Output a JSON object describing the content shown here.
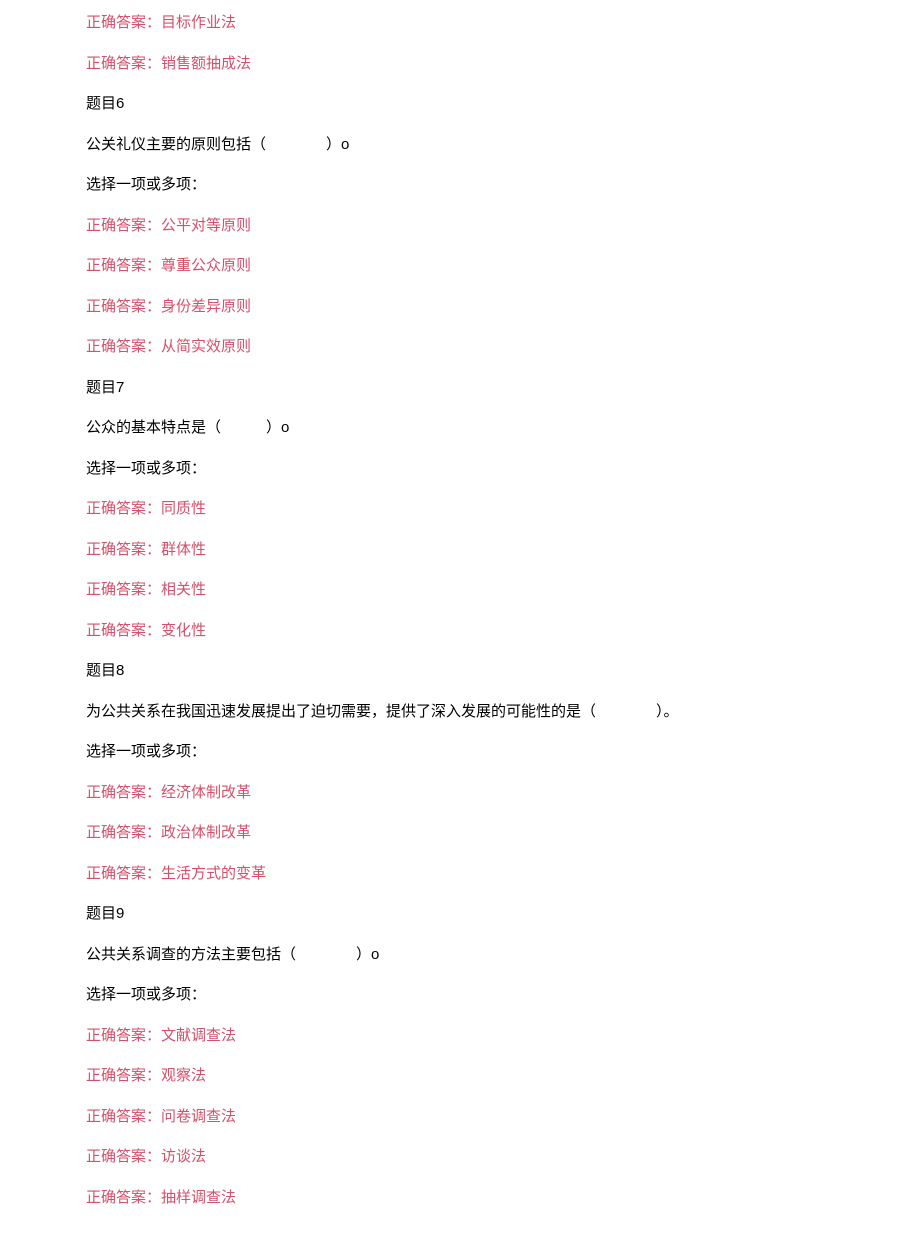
{
  "top_answers": [
    "正确答案：目标作业法",
    "正确答案：销售额抽成法"
  ],
  "q6": {
    "title": "题目6",
    "prompt": "公关礼仪主要的原则包括（　　　　）o",
    "instruction": "选择一项或多项：",
    "answers": [
      "正确答案：公平对等原则",
      "正确答案：尊重公众原则",
      "正确答案：身份差异原则",
      "正确答案：从简实效原则"
    ]
  },
  "q7": {
    "title": "题目7",
    "prompt": "公众的基本特点是（　　　）o",
    "instruction": "选择一项或多项：",
    "answers": [
      "正确答案：同质性",
      "正确答案：群体性",
      "正确答案：相关性",
      "正确答案：变化性"
    ]
  },
  "q8": {
    "title": "题目8",
    "prompt": "为公共关系在我国迅速发展提出了迫切需要，提供了深入发展的可能性的是（　　　　）。",
    "instruction": "选择一项或多项：",
    "answers": [
      "正确答案：经济体制改革",
      "正确答案：政治体制改革",
      "正确答案：生活方式的变革"
    ]
  },
  "q9": {
    "title": "题目9",
    "prompt": "公共关系调查的方法主要包括（　　　　）o",
    "instruction": "选择一项或多项：",
    "answers": [
      "正确答案：文献调查法",
      "正确答案：观察法",
      "正确答案：问卷调查法",
      "正确答案：访谈法",
      "正确答案：抽样调查法"
    ]
  }
}
